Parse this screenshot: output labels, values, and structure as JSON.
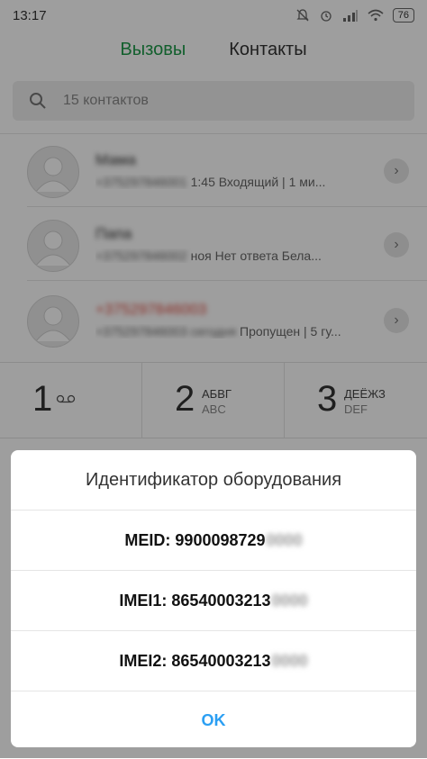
{
  "status": {
    "time": "13:17",
    "battery": "76",
    "icons": [
      "mute-icon",
      "alarm-icon",
      "signal-icon",
      "wifi-icon",
      "battery-icon"
    ]
  },
  "tabs": [
    {
      "label": "Вызовы",
      "active": true
    },
    {
      "label": "Контакты",
      "active": false
    }
  ],
  "search": {
    "placeholder": "15 контактов"
  },
  "calls": [
    {
      "name": "Мама",
      "number": "+375297846001",
      "detail": "1:45 Входящий | 1 ми...",
      "missed": false
    },
    {
      "name": "Папа",
      "number": "+375297846002",
      "detail": "ноя Нет ответа  Бела...",
      "missed": false
    },
    {
      "name": "+375297846003",
      "number": "+375297846003  сегодня",
      "detail": "Пропущен | 5 гу...",
      "missed": true
    }
  ],
  "dialpad": {
    "keys": [
      {
        "digit": "1",
        "letters": "",
        "latin": "",
        "icon": "voicemail-icon"
      },
      {
        "digit": "2",
        "letters": "АБВГ",
        "latin": "ABC"
      },
      {
        "digit": "3",
        "letters": "ДЕЁЖЗ",
        "latin": "DEF"
      }
    ]
  },
  "dialog": {
    "title": "Идентификатор оборудования",
    "rows": [
      {
        "label": "MEID: 9900098729",
        "masked": "0000"
      },
      {
        "label": "IMEI1: 86540003213",
        "masked": "0000"
      },
      {
        "label": "IMEI2: 86540003213",
        "masked": "0000"
      }
    ],
    "ok": "OK"
  },
  "colors": {
    "accent_green": "#1d9a49",
    "missed_red": "#e0473b",
    "ok_blue": "#2b9ff3"
  }
}
